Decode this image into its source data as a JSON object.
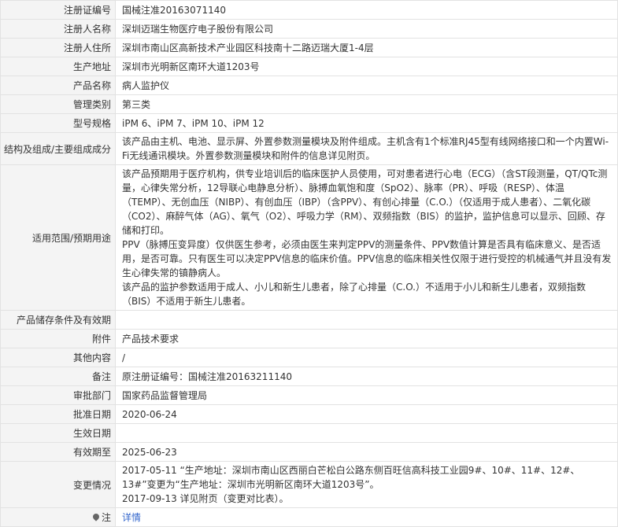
{
  "rows": [
    {
      "label": "注册证编号",
      "value": "国械注准20163071140"
    },
    {
      "label": "注册人名称",
      "value": "深圳迈瑞生物医疗电子股份有限公司"
    },
    {
      "label": "注册人住所",
      "value": "深圳市南山区高新技术产业园区科技南十二路迈瑞大厦1-4层"
    },
    {
      "label": "生产地址",
      "value": "深圳市光明新区南环大道1203号"
    },
    {
      "label": "产品名称",
      "value": "病人监护仪"
    },
    {
      "label": "管理类别",
      "value": "第三类"
    },
    {
      "label": "型号规格",
      "value": "iPM 6、iPM 7、iPM 10、iPM 12"
    },
    {
      "label": "结构及组成/主要组成成分",
      "value": "该产品由主机、电池、显示屏、外置参数测量模块及附件组成。主机含有1个标准RJ45型有线网络接口和一个内置Wi-Fi无线通讯模块。外置参数测量模块和附件的信息详见附页。"
    },
    {
      "label": "适用范围/预期用途",
      "paragraphs": [
        "该产品预期用于医疗机构，供专业培训后的临床医护人员使用，可对患者进行心电（ECG）（含ST段测量，QT/QTc测量，心律失常分析，12导联心电静息分析）、脉搏血氧饱和度（SpO2）、脉率（PR）、呼吸（RESP）、体温（TEMP）、无创血压（NIBP）、有创血压（IBP）（含PPV）、有创心排量（C.O.）（仅适用于成人患者）、二氧化碳（CO2）、麻醉气体（AG）、氧气（O2）、呼吸力学（RM）、双频指数（BIS）的监护，监护信息可以显示、回顾、存储和打印。",
        "PPV（脉搏压变异度）仅供医生参考，必须由医生来判定PPV的测量条件、PPV数值计算是否具有临床意义、是否适用，是否可靠。只有医生可以决定PPV信息的临床价值。PPV信息的临床相关性仅限于进行受控的机械通气并且没有发生心律失常的镇静病人。",
        "该产品的监护参数适用于成人、小儿和新生儿患者，除了心排量（C.O.）不适用于小儿和新生儿患者，双频指数（BIS）不适用于新生儿患者。"
      ]
    },
    {
      "label": "产品储存条件及有效期",
      "value": ""
    },
    {
      "label": "附件",
      "value": "产品技术要求"
    },
    {
      "label": "其他内容",
      "value": "/"
    },
    {
      "label": "备注",
      "value": "原注册证编号：国械注准20163211140"
    },
    {
      "label": "审批部门",
      "value": "国家药品监督管理局"
    },
    {
      "label": "批准日期",
      "value": "2020-06-24"
    },
    {
      "label": "生效日期",
      "value": ""
    },
    {
      "label": "有效期至",
      "value": "2025-06-23"
    },
    {
      "label": "变更情况",
      "paragraphs": [
        "2017-05-11 “生产地址：深圳市南山区西丽白芒松白公路东侧百旺信高科技工业园9#、10#、11#、12#、13#”变更为“生产地址：深圳市光明新区南环大道1203号”。",
        "2017-09-13 详见附页（变更对比表）。"
      ]
    },
    {
      "label": "注",
      "value": "详情",
      "icon": "map-pin-icon"
    }
  ]
}
